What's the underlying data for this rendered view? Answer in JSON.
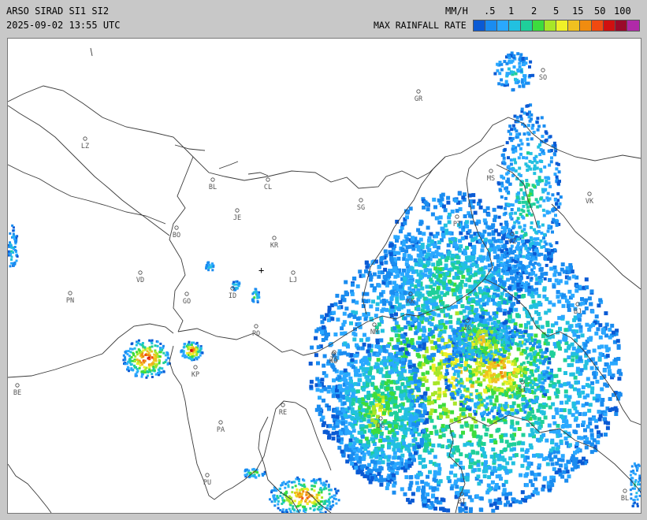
{
  "header": {
    "title": "ARSO SIRAD SI1 SI2",
    "timestamp": "2025-09-02 13:55 UTC",
    "units_label": "MM/H",
    "legend_label": "MAX RAINFALL RATE",
    "scale_ticks": [
      ".5",
      "1",
      "2",
      "5",
      "15",
      "50",
      "100"
    ],
    "scale_colors": [
      "#0a5ad4",
      "#1a8cf0",
      "#2aa8ff",
      "#22c0e0",
      "#1fcf9a",
      "#3ddc3d",
      "#a8e628",
      "#f0f028",
      "#f0c020",
      "#f08c10",
      "#f04a10",
      "#d01010",
      "#9a0a2a",
      "#b02aa8"
    ]
  },
  "map": {
    "cities": [
      {
        "code": "SO"
      },
      {
        "code": "GR"
      },
      {
        "code": "LZ"
      },
      {
        "code": "BL"
      },
      {
        "code": "CL"
      },
      {
        "code": "MS"
      },
      {
        "code": "JE"
      },
      {
        "code": "SG"
      },
      {
        "code": "VK"
      },
      {
        "code": "BO"
      },
      {
        "code": "KR"
      },
      {
        "code": "PT"
      },
      {
        "code": "VZ"
      },
      {
        "code": "VD"
      },
      {
        "code": "LJ"
      },
      {
        "code": "PN"
      },
      {
        "code": "GO"
      },
      {
        "code": "ID"
      },
      {
        "code": "KK"
      },
      {
        "code": "BJ"
      },
      {
        "code": "PO"
      },
      {
        "code": "NM"
      },
      {
        "code": "ZG"
      },
      {
        "code": "TS"
      },
      {
        "code": "KO"
      },
      {
        "code": "KP"
      },
      {
        "code": "SI"
      },
      {
        "code": "BE"
      },
      {
        "code": "RE"
      },
      {
        "code": "OG"
      },
      {
        "code": "PA"
      },
      {
        "code": "PU"
      },
      {
        "code": "BI"
      },
      {
        "code": "BL"
      }
    ],
    "radar_center_symbol": "+"
  }
}
